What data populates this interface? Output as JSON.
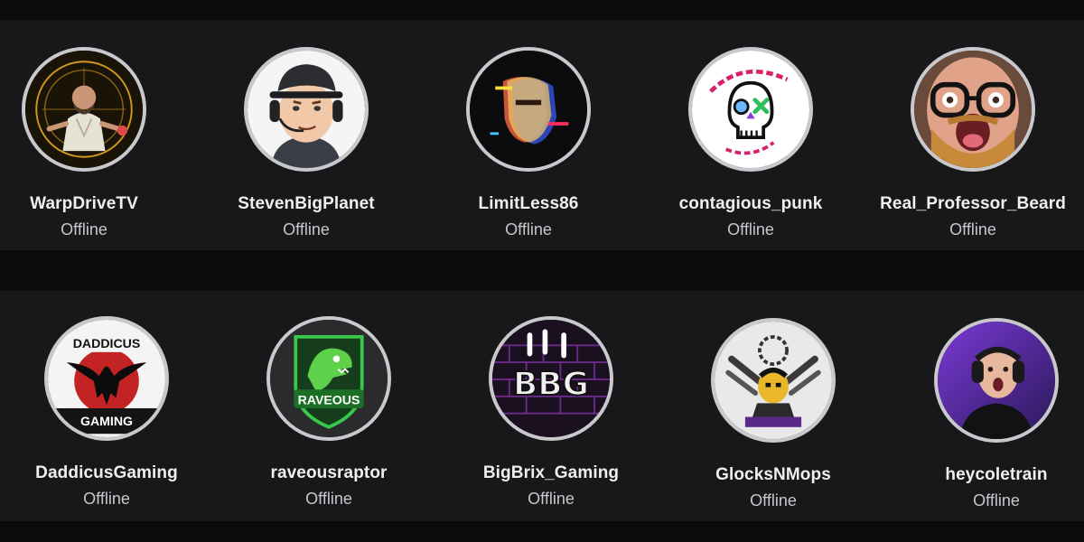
{
  "rows": [
    {
      "channels": [
        {
          "name": "WarpDriveTV",
          "status": "Offline",
          "avatar_icon": "warrior-avatar-icon"
        },
        {
          "name": "StevenBigPlanet",
          "status": "Offline",
          "avatar_icon": "headset-cartoon-avatar-icon"
        },
        {
          "name": "LimitLess86",
          "status": "Offline",
          "avatar_icon": "glitch-face-avatar-icon"
        },
        {
          "name": "contagious_punk",
          "status": "Offline",
          "avatar_icon": "skull-logo-avatar-icon"
        },
        {
          "name": "Real_Professor_Beard",
          "status": "Offline",
          "avatar_icon": "glasses-beard-avatar-icon"
        }
      ]
    },
    {
      "channels": [
        {
          "name": "DaddicusGaming",
          "status": "Offline",
          "avatar_icon": "raven-logo-avatar-icon",
          "logo_top": "DADDICUS",
          "logo_bottom": "GAMING"
        },
        {
          "name": "raveousraptor",
          "status": "Offline",
          "avatar_icon": "raptor-logo-avatar-icon",
          "logo_text": "RAVEOUS"
        },
        {
          "name": "BigBrix_Gaming",
          "status": "Offline",
          "avatar_icon": "bbg-logo-avatar-icon",
          "logo_text": "BBG"
        },
        {
          "name": "GlocksNMops",
          "status": "Offline",
          "avatar_icon": "character-logo-avatar-icon"
        },
        {
          "name": "heycoletrain",
          "status": "Offline",
          "avatar_icon": "headphones-person-avatar-icon"
        }
      ]
    }
  ],
  "colors": {
    "page_bg": "#0b0b0d",
    "panel_bg": "#18181b",
    "avatar_ring": "#c9c9cd",
    "name_text": "#efeff1",
    "status_text": "#c8c8cc"
  }
}
